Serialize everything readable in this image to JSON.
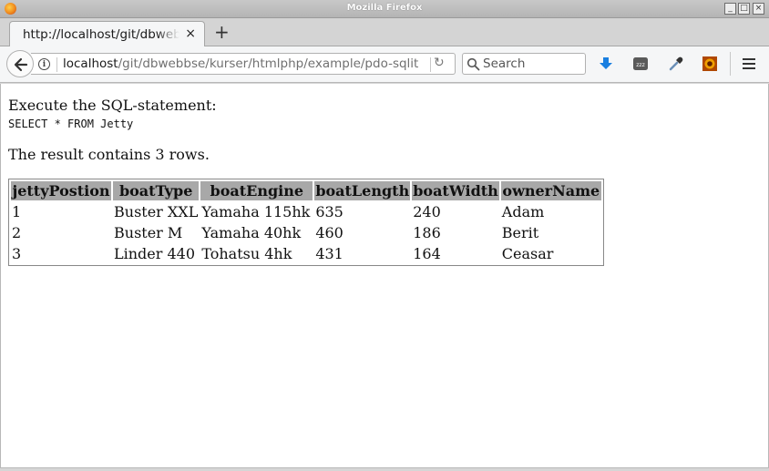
{
  "window": {
    "title": "Mozilla Firefox",
    "controls": {
      "minimize": "_",
      "maximize": "□",
      "close": "×"
    }
  },
  "tab": {
    "title": "http://localhost/git/dbwebbse/kurser/htmlphp/example/pdo-sqlite/",
    "close": "×",
    "new_tab": "+"
  },
  "url": {
    "host": "localhost",
    "path": "/git/dbwebbse/kurser/htmlphp/example/pdo-sqlit",
    "reload": "↻"
  },
  "search": {
    "placeholder": "Search"
  },
  "toolbar": {
    "icons": [
      "download-icon",
      "sleep-icon",
      "eyedropper-icon",
      "addon-icon",
      "menu-icon"
    ],
    "sleep_text": "zzz"
  },
  "page": {
    "intro": "Execute the SQL-statement:",
    "sql": "SELECT * FROM Jetty",
    "result": "The result contains 3 rows."
  },
  "table": {
    "headers": [
      "jettyPostion",
      "boatType",
      "boatEngine",
      "boatLength",
      "boatWidth",
      "ownerName"
    ],
    "rows": [
      [
        "1",
        "Buster XXL",
        "Yamaha 115hk",
        "635",
        "240",
        "Adam"
      ],
      [
        "2",
        "Buster M",
        "Yamaha 40hk",
        "460",
        "186",
        "Berit"
      ],
      [
        "3",
        "Linder 440",
        "Tohatsu 4hk",
        "431",
        "164",
        "Ceasar"
      ]
    ]
  },
  "colors": {
    "header_bg": "#a8a8a8",
    "download_blue": "#1a7fe0",
    "addon_orange": "#e08a00"
  }
}
